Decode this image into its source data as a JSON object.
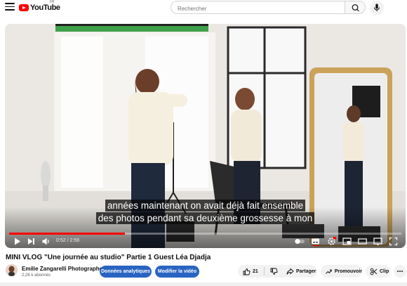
{
  "header": {
    "logo_text": "YouTube",
    "region": "FR",
    "search_placeholder": "Rechercher"
  },
  "player": {
    "subtitle_line1": "années maintenant on avait déjà fait ensemble",
    "subtitle_line2": "des photos pendant sa deuxième grossesse à mon",
    "time": "0:52 / 2:56",
    "progress_fraction": 0.2955
  },
  "video": {
    "title": "MINI VLOG \"Une journée au studio\" Partie 1 Guest Léa Djadja"
  },
  "channel": {
    "name": "Emilie Zangarelli Photographe",
    "subscribers": "2,26 k abonnés"
  },
  "actions": {
    "analytics": "Données analytiques",
    "edit_video": "Modifier la vidéo",
    "like_count": "21",
    "share": "Partager",
    "promote": "Promouvoir",
    "clip": "Clip"
  },
  "colors": {
    "brand": "#ff0000",
    "primary_button": "#2964c2"
  }
}
